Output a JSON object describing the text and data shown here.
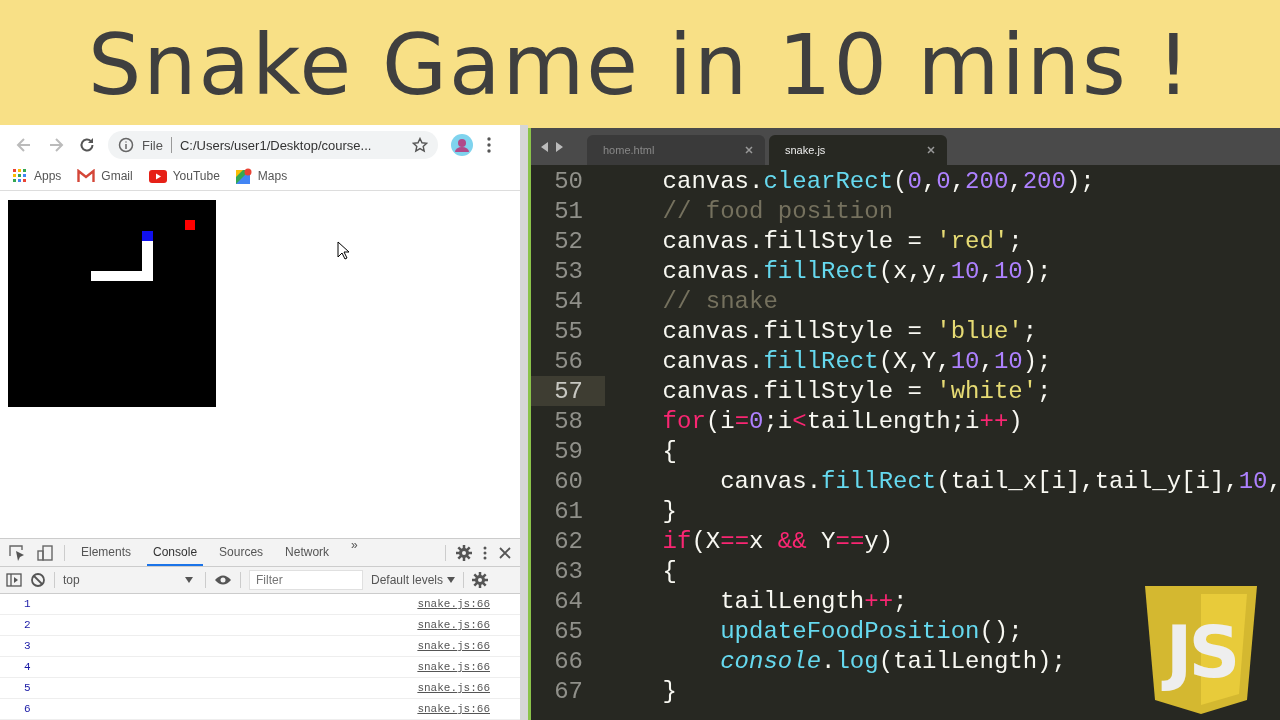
{
  "banner": {
    "title": "Snake Game in 10 mins !"
  },
  "browser": {
    "address": {
      "scheme": "File",
      "url": "C:/Users/user1/Desktop/course..."
    },
    "bookmarks": [
      {
        "label": "Apps",
        "kind": "apps"
      },
      {
        "label": "Gmail",
        "kind": "gmail"
      },
      {
        "label": "YouTube",
        "kind": "youtube"
      },
      {
        "label": "Maps",
        "kind": "maps"
      }
    ],
    "devtools": {
      "tabs": [
        {
          "label": "Elements",
          "selected": false
        },
        {
          "label": "Console",
          "selected": true
        },
        {
          "label": "Sources",
          "selected": false
        },
        {
          "label": "Network",
          "selected": false
        }
      ],
      "more": "»",
      "context": "top",
      "filter_placeholder": "Filter",
      "levels": "Default levels",
      "console": [
        {
          "value": "1",
          "source": "snake.js:66"
        },
        {
          "value": "2",
          "source": "snake.js:66"
        },
        {
          "value": "3",
          "source": "snake.js:66"
        },
        {
          "value": "4",
          "source": "snake.js:66"
        },
        {
          "value": "5",
          "source": "snake.js:66"
        },
        {
          "value": "6",
          "source": "snake.js:66"
        }
      ]
    }
  },
  "editor": {
    "tabs": [
      {
        "label": "home.html",
        "selected": false
      },
      {
        "label": "snake.js",
        "selected": true
      }
    ],
    "lines": [
      {
        "number": "50",
        "current": false,
        "tokens": [
          {
            "kind": "plain",
            "text": "    canvas."
          },
          {
            "kind": "fn",
            "text": "clearRect"
          },
          {
            "kind": "plain",
            "text": "("
          },
          {
            "kind": "num",
            "text": "0"
          },
          {
            "kind": "plain",
            "text": ","
          },
          {
            "kind": "num",
            "text": "0"
          },
          {
            "kind": "plain",
            "text": ","
          },
          {
            "kind": "num",
            "text": "200"
          },
          {
            "kind": "plain",
            "text": ","
          },
          {
            "kind": "num",
            "text": "200"
          },
          {
            "kind": "plain",
            "text": ");"
          }
        ]
      },
      {
        "number": "51",
        "current": false,
        "tokens": [
          {
            "kind": "comment",
            "text": "    // food position"
          }
        ]
      },
      {
        "number": "52",
        "current": false,
        "tokens": [
          {
            "kind": "plain",
            "text": "    canvas.fillStyle = "
          },
          {
            "kind": "str",
            "text": "'red'"
          },
          {
            "kind": "plain",
            "text": ";"
          }
        ]
      },
      {
        "number": "53",
        "current": false,
        "tokens": [
          {
            "kind": "plain",
            "text": "    canvas."
          },
          {
            "kind": "fn",
            "text": "fillRect"
          },
          {
            "kind": "plain",
            "text": "(x,y,"
          },
          {
            "kind": "num",
            "text": "10"
          },
          {
            "kind": "plain",
            "text": ","
          },
          {
            "kind": "num",
            "text": "10"
          },
          {
            "kind": "plain",
            "text": ");"
          }
        ]
      },
      {
        "number": "54",
        "current": false,
        "tokens": [
          {
            "kind": "comment",
            "text": "    // snake"
          }
        ]
      },
      {
        "number": "55",
        "current": false,
        "tokens": [
          {
            "kind": "plain",
            "text": "    canvas.fillStyle = "
          },
          {
            "kind": "str",
            "text": "'blue'"
          },
          {
            "kind": "plain",
            "text": ";"
          }
        ]
      },
      {
        "number": "56",
        "current": false,
        "tokens": [
          {
            "kind": "plain",
            "text": "    canvas."
          },
          {
            "kind": "fn",
            "text": "fillRect"
          },
          {
            "kind": "plain",
            "text": "(X,Y,"
          },
          {
            "kind": "num",
            "text": "10"
          },
          {
            "kind": "plain",
            "text": ","
          },
          {
            "kind": "num",
            "text": "10"
          },
          {
            "kind": "plain",
            "text": ");"
          }
        ]
      },
      {
        "number": "57",
        "current": true,
        "tokens": [
          {
            "kind": "plain",
            "text": "    canvas.fillStyle = "
          },
          {
            "kind": "str",
            "text": "'white'"
          },
          {
            "kind": "plain",
            "text": ";"
          }
        ]
      },
      {
        "number": "58",
        "current": false,
        "tokens": [
          {
            "kind": "kw",
            "text": "    for"
          },
          {
            "kind": "plain",
            "text": "(i"
          },
          {
            "kind": "kw",
            "text": "="
          },
          {
            "kind": "num",
            "text": "0"
          },
          {
            "kind": "plain",
            "text": ";i"
          },
          {
            "kind": "kw",
            "text": "<"
          },
          {
            "kind": "plain",
            "text": "tailLength;i"
          },
          {
            "kind": "kw",
            "text": "++"
          },
          {
            "kind": "plain",
            "text": ")"
          }
        ]
      },
      {
        "number": "59",
        "current": false,
        "tokens": [
          {
            "kind": "plain",
            "text": "    {"
          }
        ]
      },
      {
        "number": "60",
        "current": false,
        "tokens": [
          {
            "kind": "plain",
            "text": "        canvas."
          },
          {
            "kind": "fn",
            "text": "fillRect"
          },
          {
            "kind": "plain",
            "text": "(tail_x[i],tail_y[i],"
          },
          {
            "kind": "num",
            "text": "10"
          },
          {
            "kind": "plain",
            "text": ","
          }
        ]
      },
      {
        "number": "61",
        "current": false,
        "tokens": [
          {
            "kind": "plain",
            "text": "    }"
          }
        ]
      },
      {
        "number": "62",
        "current": false,
        "tokens": [
          {
            "kind": "kw",
            "text": "    if"
          },
          {
            "kind": "plain",
            "text": "(X"
          },
          {
            "kind": "kw",
            "text": "=="
          },
          {
            "kind": "plain",
            "text": "x "
          },
          {
            "kind": "kw",
            "text": "&&"
          },
          {
            "kind": "plain",
            "text": " Y"
          },
          {
            "kind": "kw",
            "text": "=="
          },
          {
            "kind": "plain",
            "text": "y)"
          }
        ]
      },
      {
        "number": "63",
        "current": false,
        "tokens": [
          {
            "kind": "plain",
            "text": "    {"
          }
        ]
      },
      {
        "number": "64",
        "current": false,
        "tokens": [
          {
            "kind": "plain",
            "text": "        tailLength"
          },
          {
            "kind": "kw",
            "text": "++"
          },
          {
            "kind": "plain",
            "text": ";"
          }
        ]
      },
      {
        "number": "65",
        "current": false,
        "tokens": [
          {
            "kind": "fn",
            "text": "        updateFoodPosition"
          },
          {
            "kind": "plain",
            "text": "();"
          }
        ]
      },
      {
        "number": "66",
        "current": false,
        "tokens": [
          {
            "kind": "builtin",
            "text": "        console"
          },
          {
            "kind": "plain",
            "text": "."
          },
          {
            "kind": "fn",
            "text": "log"
          },
          {
            "kind": "plain",
            "text": "(tailLength);"
          }
        ]
      },
      {
        "number": "67",
        "current": false,
        "tokens": [
          {
            "kind": "plain",
            "text": "    }"
          }
        ]
      }
    ]
  },
  "logo": {
    "text": "JS"
  }
}
